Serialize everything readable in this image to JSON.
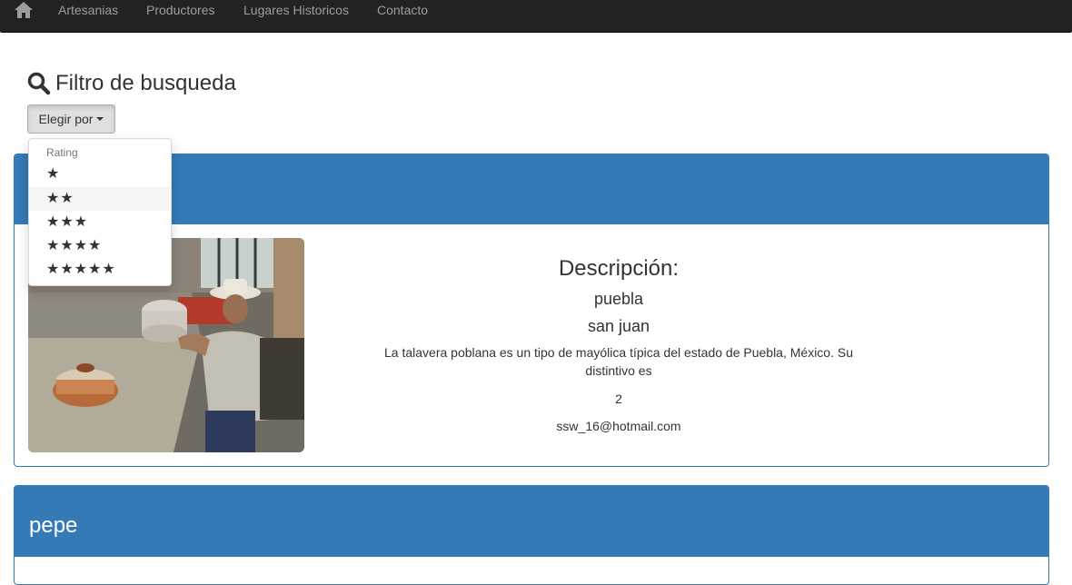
{
  "nav": {
    "home_icon": "home-icon",
    "items": [
      "Artesanias",
      "Productores",
      "Lugares Historicos",
      "Contacto"
    ]
  },
  "filter": {
    "icon": "search-icon",
    "title": "Filtro de busqueda",
    "button_label": "Elegir por",
    "menu": {
      "header": "Rating",
      "items": [
        "★",
        "★★",
        "★★★",
        "★★★★",
        "★★★★★"
      ],
      "hovered_index": 1
    }
  },
  "cards": [
    {
      "title": "",
      "image": "artisan-photo",
      "description_label": "Descripción:",
      "state": "puebla",
      "city": "san juan",
      "text": "La talavera poblana es un tipo de mayólica típica del estado de Puebla, México. Su distintivo es",
      "rating": "2",
      "email": "ssw_16@hotmail.com"
    },
    {
      "title": "pepe"
    }
  ],
  "colors": {
    "navbar": "#222222",
    "nav_text": "#9d9d9d",
    "panel_primary": "#337ab7"
  }
}
